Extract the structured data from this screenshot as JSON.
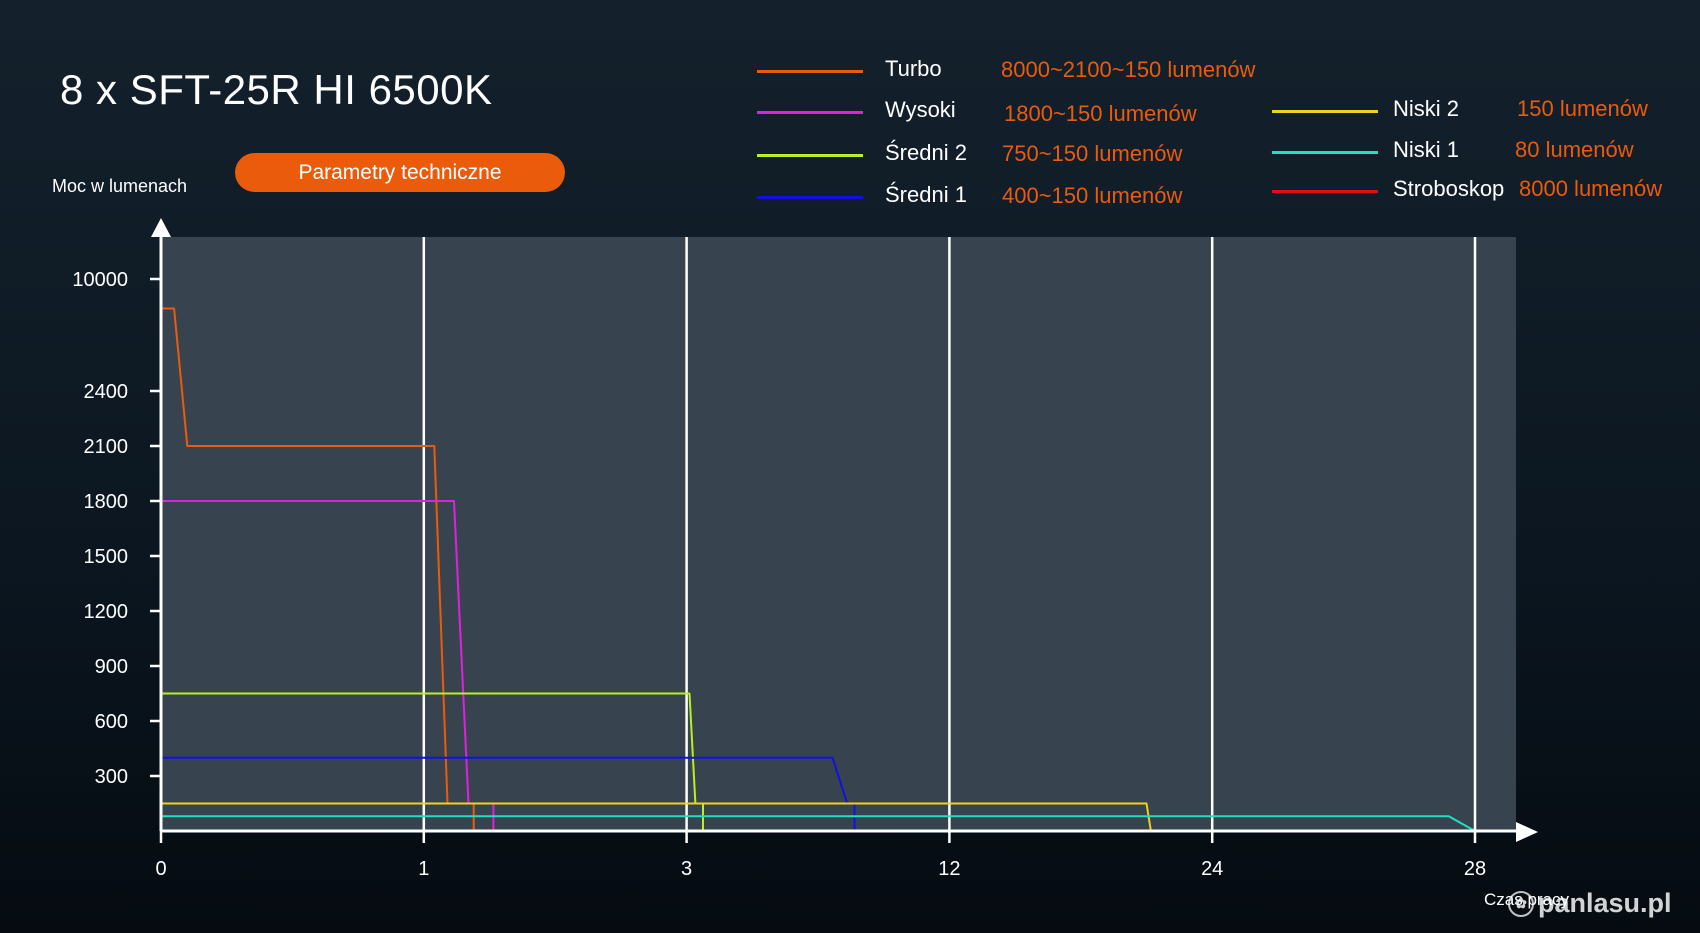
{
  "title": "8 x SFT-25R HI 6500K",
  "button": {
    "label": "Parametry techniczne"
  },
  "watermark": "panlasu.pl",
  "legend": [
    {
      "name": "Turbo",
      "desc": "8000~2100~150 lumenów",
      "color": "#ea5b0c"
    },
    {
      "name": "Wysoki",
      "desc": "1800~150 lumenów",
      "color": "#e020e0"
    },
    {
      "name": "Średni 2",
      "desc": "750~150 lumenów",
      "color": "#b8f020"
    },
    {
      "name": "Średni 1",
      "desc": "400~150 lumenów",
      "color": "#1010e0"
    },
    {
      "name": "Niski 2",
      "desc": "150 lumenów",
      "color": "#f0d020"
    },
    {
      "name": "Niski 1",
      "desc": "80 lumenów",
      "color": "#20e0c0"
    },
    {
      "name": "Stroboskop",
      "desc": "8000 lumenów",
      "color": "#e01010"
    }
  ],
  "colors": {
    "desc_text": "#ea5b0c",
    "plot_bg": "#37444f",
    "axis": "#ffffff"
  },
  "chart_data": {
    "type": "line",
    "title": "8 x SFT-25R HI 6500K",
    "xlabel": "Czas pracy",
    "ylabel": "Moc w lumenach",
    "x_ticks": [
      "0",
      "1",
      "3",
      "12",
      "24",
      "28"
    ],
    "y_ticks": [
      "300",
      "600",
      "900",
      "1200",
      "1500",
      "1800",
      "2100",
      "2400",
      "10000"
    ],
    "x_scale": "categorical-segments",
    "y_scale": "piecewise",
    "grid": "vertical",
    "legend_position": "top",
    "series": [
      {
        "name": "Turbo",
        "points": [
          [
            0,
            8000
          ],
          [
            0.05,
            8000
          ],
          [
            0.1,
            2100
          ],
          [
            1.08,
            2100
          ],
          [
            1.18,
            150
          ],
          [
            1.38,
            150
          ],
          [
            1.38,
            0
          ]
        ]
      },
      {
        "name": "Wysoki",
        "points": [
          [
            0,
            1800
          ],
          [
            1.23,
            1800
          ],
          [
            1.34,
            150
          ],
          [
            1.53,
            150
          ],
          [
            1.53,
            0
          ]
        ]
      },
      {
        "name": "Średni 2",
        "points": [
          [
            0,
            750
          ],
          [
            3.1,
            750
          ],
          [
            3.3,
            150
          ],
          [
            3.56,
            150
          ],
          [
            3.56,
            0
          ]
        ]
      },
      {
        "name": "Średni 1",
        "points": [
          [
            0,
            400
          ],
          [
            8.0,
            400
          ],
          [
            8.5,
            150
          ],
          [
            8.75,
            150
          ],
          [
            8.75,
            0
          ]
        ]
      },
      {
        "name": "Niski 2",
        "points": [
          [
            0,
            150
          ],
          [
            21.0,
            150
          ],
          [
            21.2,
            0
          ]
        ]
      },
      {
        "name": "Niski 1",
        "points": [
          [
            0,
            80
          ],
          [
            27.6,
            80
          ],
          [
            28.0,
            0
          ]
        ]
      }
    ]
  }
}
